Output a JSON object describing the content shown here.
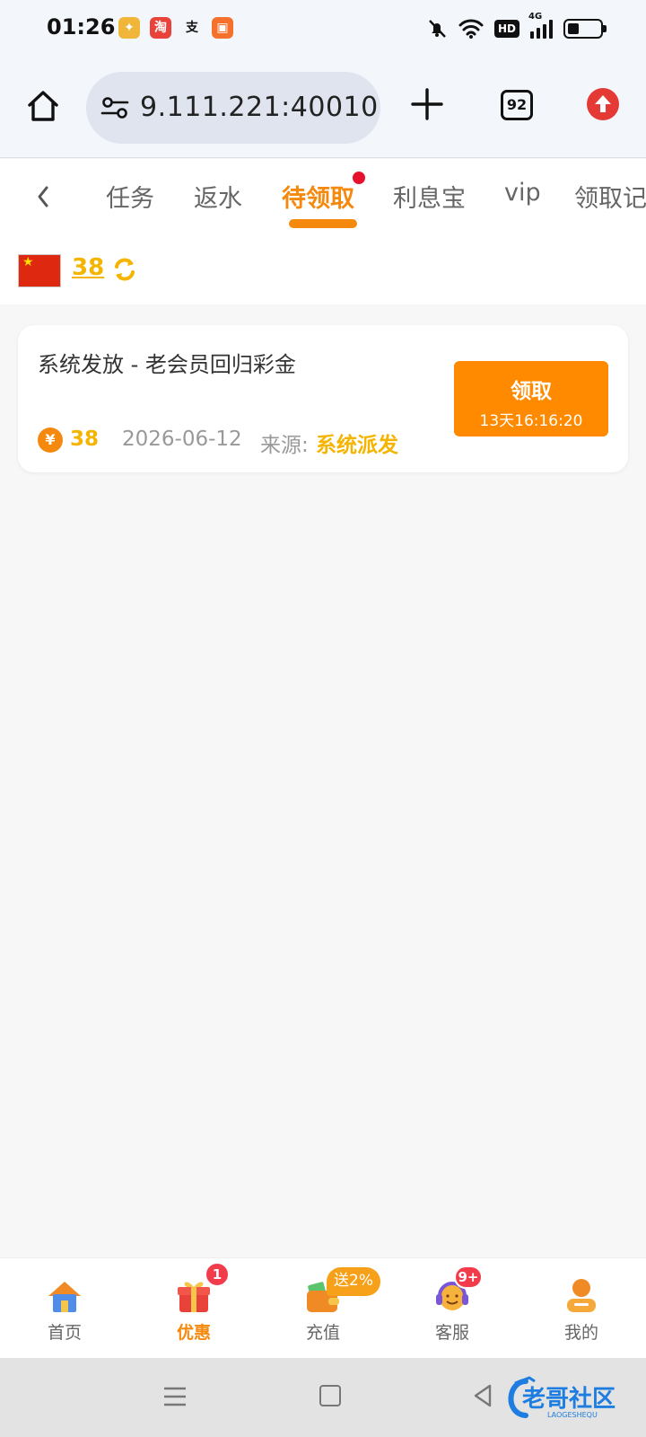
{
  "status_bar": {
    "time": "01:26",
    "app_icons": [
      "taobao-badge-icon",
      "alipay-icon",
      "kuaishou-icon"
    ],
    "hd_label": "HD",
    "network_label": "4G"
  },
  "browser": {
    "url": "9.111.221:40010",
    "tab_count": "92"
  },
  "tabs": {
    "items": [
      {
        "label": "任务"
      },
      {
        "label": "返水"
      },
      {
        "label": "待领取"
      },
      {
        "label": "利息宝"
      },
      {
        "label": "vip"
      },
      {
        "label": "领取记"
      }
    ],
    "active_index": 2
  },
  "balance": {
    "value": "38"
  },
  "reward_card": {
    "title": "系统发放 - 老会员回归彩金",
    "coin_symbol": "¥",
    "amount": "38",
    "date": "2026-06-12",
    "source_label": "来源:",
    "source_value": "系统派发",
    "claim_label": "领取",
    "claim_countdown": "13天16:16:20"
  },
  "bottom_nav": {
    "items": [
      {
        "label": "首页",
        "icon": "house-icon"
      },
      {
        "label": "优惠",
        "icon": "gift-icon",
        "badge": "1"
      },
      {
        "label": "充值",
        "icon": "wallet-icon",
        "promo": "送2%"
      },
      {
        "label": "客服",
        "icon": "support-agent-icon",
        "badge": "9+"
      },
      {
        "label": "我的",
        "icon": "profile-icon"
      }
    ],
    "active_index": 1
  },
  "watermark": {
    "text": "老哥社区",
    "subtext": "LAOGESHEQU"
  },
  "colors": {
    "accent": "#f5890e",
    "gold": "#f4b400",
    "badge_red": "#f23c4c",
    "claim_button": "#ff8a00"
  }
}
